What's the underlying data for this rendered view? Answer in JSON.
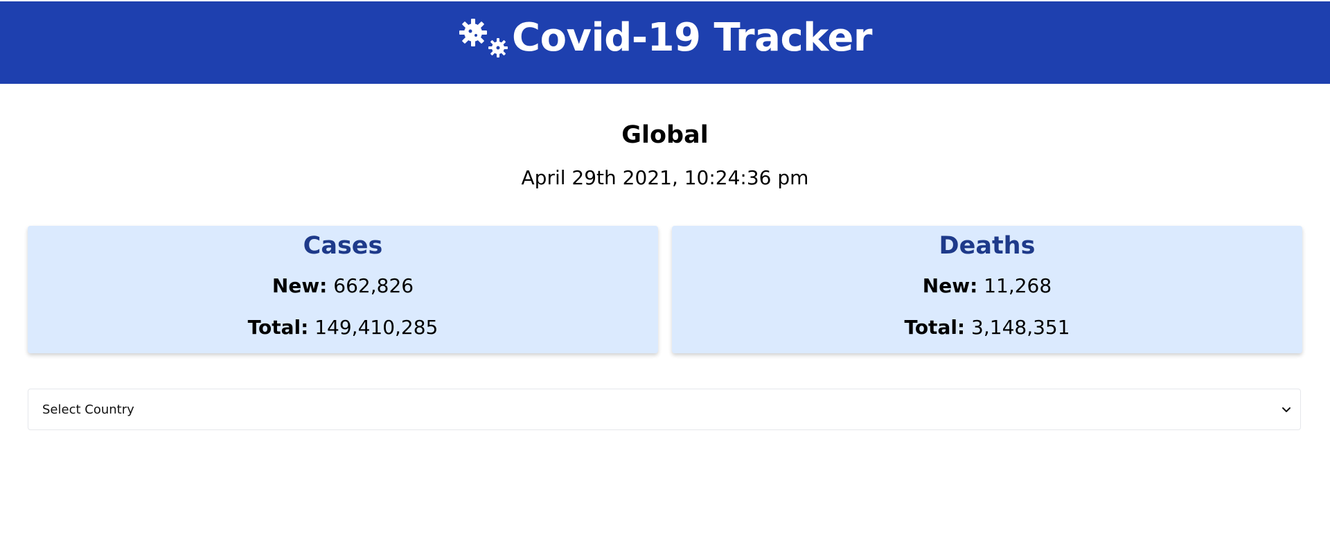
{
  "header": {
    "title": "Covid-19 Tracker",
    "icon": "virus-icon",
    "background": "#1e40af"
  },
  "region": {
    "title": "Global",
    "timestamp": "April 29th 2021, 10:24:36 pm"
  },
  "cards": [
    {
      "title": "Cases",
      "new_label": "New:",
      "new_value": "662,826",
      "total_label": "Total:",
      "total_value": "149,410,285"
    },
    {
      "title": "Deaths",
      "new_label": "New:",
      "new_value": "11,268",
      "total_label": "Total:",
      "total_value": "3,148,351"
    }
  ],
  "country_select": {
    "selected": "Select Country",
    "icon": "chevron-down-icon"
  },
  "colors": {
    "card_background": "#dbeafe",
    "card_title": "#1e3a8a"
  }
}
